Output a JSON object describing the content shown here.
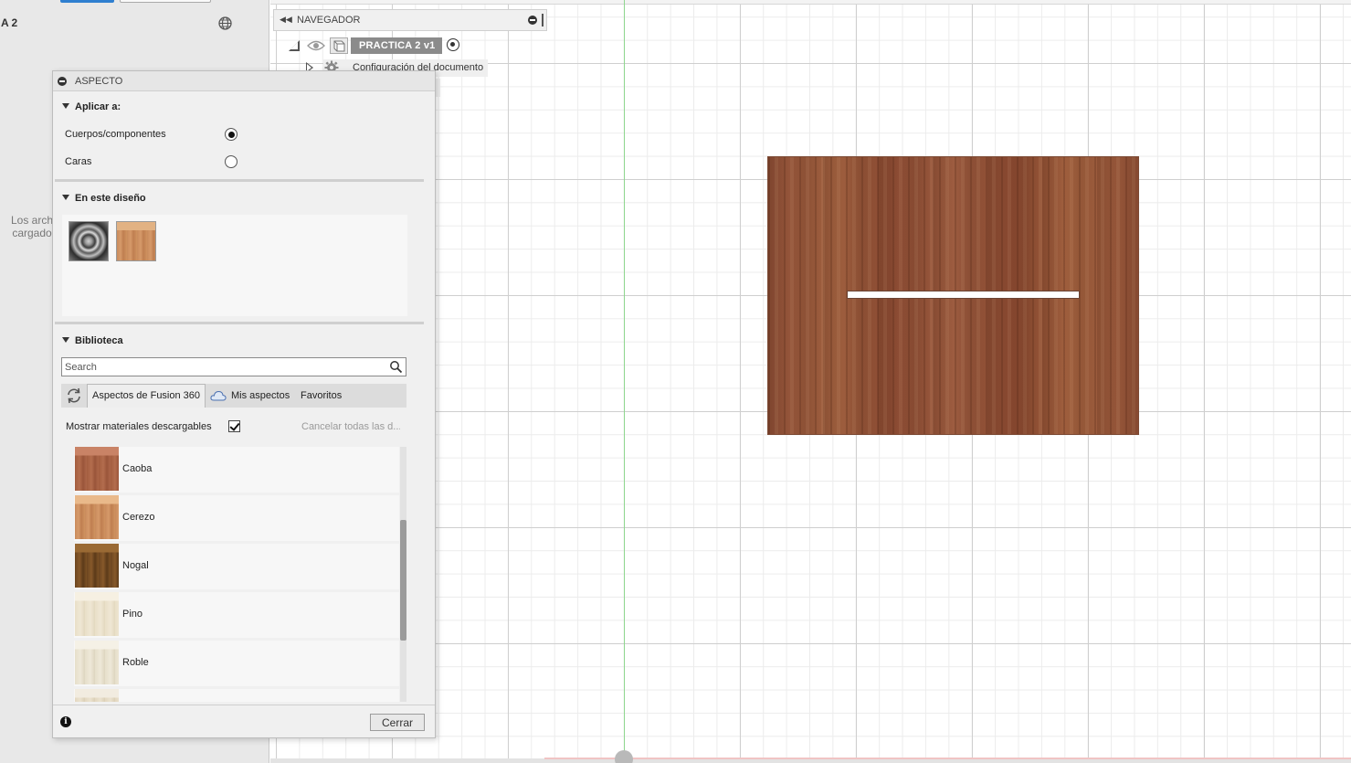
{
  "left_panel": {
    "title": "A 2",
    "message_line1": "Los arch",
    "message_line2": "cargado"
  },
  "navigator": {
    "title": "NAVEGADOR",
    "root_label": "PRACTICA 2 v1",
    "doc_settings_label": "Configuración del documento"
  },
  "dialog": {
    "title": "ASPECTO",
    "apply_to": {
      "heading": "Aplicar a:",
      "options": [
        {
          "label": "Cuerpos/componentes",
          "selected": true
        },
        {
          "label": "Caras",
          "selected": false
        }
      ]
    },
    "in_design": {
      "heading": "En este diseño",
      "thumbnails": [
        "chrome-material",
        "wood-material"
      ]
    },
    "library": {
      "heading": "Biblioteca",
      "search_placeholder": "Search",
      "tabs": [
        {
          "label": "Aspectos de Fusion 360",
          "active": true
        },
        {
          "label": "Mis aspectos",
          "active": false
        },
        {
          "label": "Favoritos",
          "active": false
        }
      ],
      "show_downloadable_label": "Mostrar materiales descargables",
      "show_downloadable_checked": true,
      "cancel_all_label": "Cancelar todas las d..."
    },
    "materials": [
      {
        "name": "Caoba",
        "color": "#b06a4a"
      },
      {
        "name": "Cerezo",
        "color": "#d49560"
      },
      {
        "name": "Nogal",
        "color": "#7a5326"
      },
      {
        "name": "Pino",
        "color": "#ece3cf"
      },
      {
        "name": "Roble",
        "color": "#ebe4d2"
      },
      {
        "name": "",
        "color": "#e6dcc6"
      }
    ],
    "close_label": "Cerrar"
  },
  "colors": {
    "accent_blue": "#2f7fd0",
    "wood_board": "#97553c",
    "axis_green": "#8fd68f"
  },
  "icons": {
    "globe": "globe-icon",
    "search": "search-icon",
    "refresh": "refresh-icon",
    "cloud": "cloud-icon",
    "info": "info-icon",
    "eye": "eye-icon",
    "gear": "gear-icon"
  }
}
